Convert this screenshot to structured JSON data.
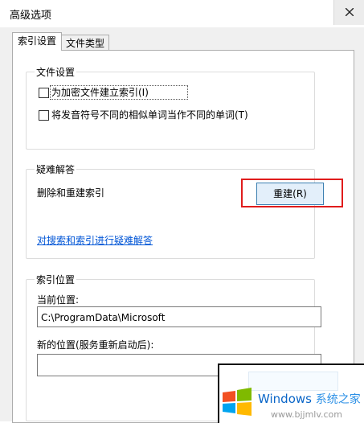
{
  "window": {
    "title": "高级选项"
  },
  "tabs": [
    {
      "label": "索引设置",
      "selected": true
    },
    {
      "label": "文件类型",
      "selected": false
    }
  ],
  "file_settings": {
    "title": "文件设置",
    "options": [
      {
        "label": "为加密文件建立索引(I)",
        "checked": false
      },
      {
        "label": "将发音符号不同的相似单词当作不同的单词(T)",
        "checked": false
      }
    ]
  },
  "troubleshoot": {
    "title": "疑难解答",
    "rebuild_label": "删除和重建索引",
    "rebuild_button": "重建(R)",
    "link": "对搜索和索引进行疑难解答"
  },
  "index_location": {
    "title": "索引位置",
    "current_label": "当前位置:",
    "current_value": "C:\\ProgramData\\Microsoft",
    "new_label": "新的位置(服务重新启动后):",
    "new_value": ""
  },
  "watermark": {
    "brand": "Windows",
    "brand_cn": "系统之家",
    "url": "www.bjjmlv.com"
  },
  "colors": {
    "highlight": "#e01c1c",
    "link": "#0055d6",
    "button_border": "#3c7fb1"
  }
}
